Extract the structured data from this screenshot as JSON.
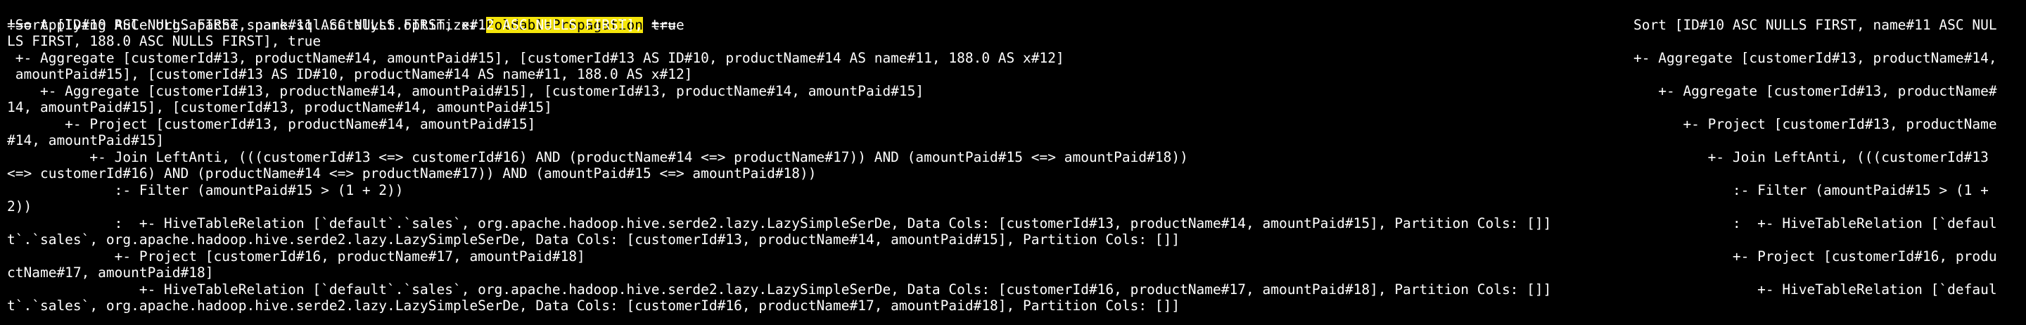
{
  "header": {
    "prefix": "=== Applying Rule org.apache.spark.sql.catalyst.optimizer.",
    "highlight": "FoldablePropagation",
    "suffix": " ==="
  },
  "left_lines": [
    "!Sort [ID#10 ASC NULLS FIRST, name#11 ASC NULLS FIRST, x#12 ASC NULLS FIRST], true",
    "LS FIRST, 188.0 ASC NULLS FIRST], true",
    " +- Aggregate [customerId#13, productName#14, amountPaid#15], [customerId#13 AS ID#10, productName#14 AS name#11, 188.0 AS x#12]",
    " amountPaid#15], [customerId#13 AS ID#10, productName#14 AS name#11, 188.0 AS x#12]",
    "    +- Aggregate [customerId#13, productName#14, amountPaid#15], [customerId#13, productName#14, amountPaid#15]",
    "14, amountPaid#15], [customerId#13, productName#14, amountPaid#15]",
    "       +- Project [customerId#13, productName#14, amountPaid#15]",
    "#14, amountPaid#15]",
    "          +- Join LeftAnti, (((customerId#13 <=> customerId#16) AND (productName#14 <=> productName#17)) AND (amountPaid#15 <=> amountPaid#18))",
    "<=> customerId#16) AND (productName#14 <=> productName#17)) AND (amountPaid#15 <=> amountPaid#18))",
    "             :- Filter (amountPaid#15 > (1 + 2))",
    "2))",
    "             :  +- HiveTableRelation [`default`.`sales`, org.apache.hadoop.hive.serde2.lazy.LazySimpleSerDe, Data Cols: [customerId#13, productName#14, amountPaid#15], Partition Cols: []]",
    "t`.`sales`, org.apache.hadoop.hive.serde2.lazy.LazySimpleSerDe, Data Cols: [customerId#13, productName#14, amountPaid#15], Partition Cols: []]",
    "             +- Project [customerId#16, productName#17, amountPaid#18]",
    "ctName#17, amountPaid#18]",
    "                +- HiveTableRelation [`default`.`sales`, org.apache.hadoop.hive.serde2.lazy.LazySimpleSerDe, Data Cols: [customerId#16, productName#17, amountPaid#18], Partition Cols: []]",
    "t`.`sales`, org.apache.hadoop.hive.serde2.lazy.LazySimpleSerDe, Data Cols: [customerId#16, productName#17, amountPaid#18], Partition Cols: []]"
  ],
  "right_lines": [
    "Sort [ID#10 ASC NULLS FIRST, name#11 ASC NUL",
    "",
    "+- Aggregate [customerId#13, productName#14,",
    "",
    "   +- Aggregate [customerId#13, productName#",
    "",
    "      +- Project [customerId#13, productName",
    "",
    "         +- Join LeftAnti, (((customerId#13",
    "",
    "            :- Filter (amountPaid#15 > (1 +",
    "",
    "            :  +- HiveTableRelation [`defaul",
    "",
    "            +- Project [customerId#16, produ",
    "",
    "               +- HiveTableRelation [`defaul",
    ""
  ],
  "colors": {
    "background": "#000000",
    "text": "#ffffff",
    "highlight_bg": "#f5e50a",
    "highlight_text": "#000000"
  }
}
